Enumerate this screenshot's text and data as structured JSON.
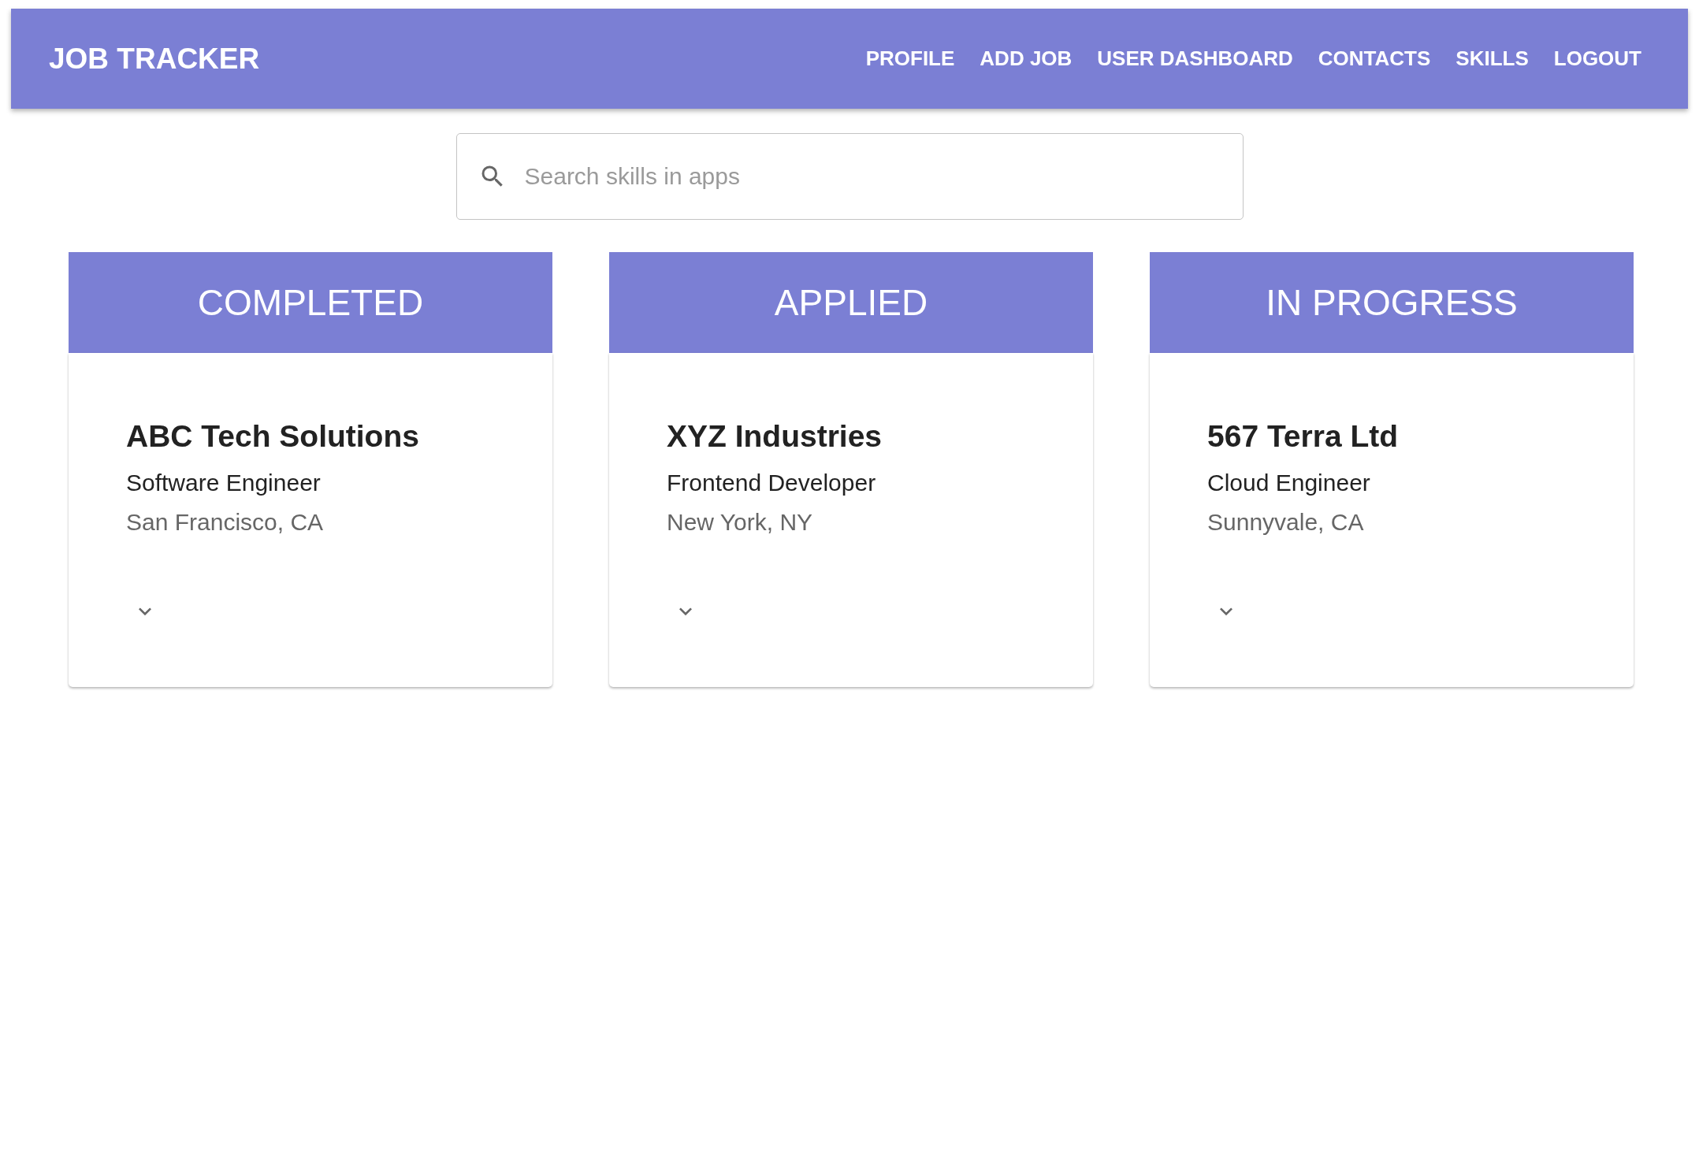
{
  "app_bar": {
    "title": "JOB TRACKER",
    "nav": [
      "PROFILE",
      "ADD JOB",
      "USER DASHBOARD",
      "CONTACTS",
      "SKILLS",
      "LOGOUT"
    ]
  },
  "search": {
    "placeholder": "Search skills in apps"
  },
  "columns": [
    {
      "title": "COMPLETED",
      "cards": [
        {
          "company": "ABC Tech Solutions",
          "role": "Software Engineer",
          "location": "San Francisco, CA",
          "expanded": false
        }
      ]
    },
    {
      "title": "APPLIED",
      "cards": [
        {
          "company": "XYZ Industries",
          "role": "Frontend Developer",
          "location": "New York, NY",
          "expanded": false
        }
      ]
    },
    {
      "title": "IN PROGRESS",
      "cards": [
        {
          "company": "567 Terra Ltd",
          "role": "Cloud Engineer",
          "location": "Sunnyvale, CA",
          "expanded": false
        }
      ]
    }
  ]
}
